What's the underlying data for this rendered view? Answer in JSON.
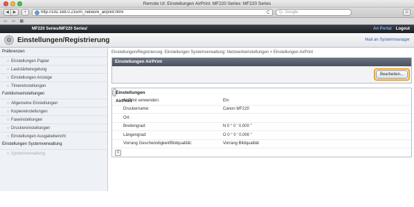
{
  "window": {
    "title": "Remote UI: Einstellungen AirPrint: MF220 Series: MF220 Series"
  },
  "browser": {
    "back": "◀",
    "forward": "▶",
    "add": "+",
    "url": "http://192.168.0.215/m_network_airprint.html",
    "reload": "C",
    "search_placeholder": "Q- Google",
    "bookmarks": [
      "▭",
      "▭",
      "▦"
    ]
  },
  "appbar": {
    "brand": "MF220 Series/MF220 Series/",
    "portal": "An Portal",
    "logout": "Logout"
  },
  "header": {
    "title": "Einstellungen/Registrierung",
    "right_link": "Mail an Systemmanager"
  },
  "sidebar": {
    "sections": [
      {
        "heading": "Präferenzen",
        "items": [
          {
            "label": "Einstellungen Papier"
          },
          {
            "label": "Lautstärkeregelung"
          },
          {
            "label": "Einstellungen Anzeige"
          },
          {
            "label": "Timereinstellungen"
          }
        ]
      },
      {
        "heading": "Funktionseinstellungen",
        "items": [
          {
            "label": "Allgemeine Einstellungen"
          },
          {
            "label": "Kopiereinstellungen"
          },
          {
            "label": "Faxeinstellungen"
          },
          {
            "label": "Druckereinstellungen"
          },
          {
            "label": "Einstellungen Ausgabebericht"
          }
        ]
      },
      {
        "heading": "Einstellungen Systemverwaltung",
        "items": [
          {
            "label": "Systemverwaltung"
          }
        ]
      }
    ]
  },
  "main": {
    "breadcrumb": "Einstellungen/Registrierung: Einstellungen Systemverwaltung: Netzwerkeinstellungen > Einstellungen AirPrint",
    "panel1": {
      "title": "Einstellungen AirPrint",
      "edit_label": "Bearbeiten..."
    },
    "panel2": {
      "title": "Einstellungen AirPrint",
      "rows": [
        {
          "key": "AirPrint verwenden:",
          "value": "Ein"
        },
        {
          "key": "Druckername:",
          "value": "Canon MF220"
        },
        {
          "key": "Ort:",
          "value": ""
        },
        {
          "key": "Breitengrad:",
          "value": "N 0 ° 0 ' 0.000 \""
        },
        {
          "key": "Längengrad:",
          "value": "O 0 ° 0 ' 0.000 \""
        },
        {
          "key": "Vorrang Geschwindigkeit/Bildqualität:",
          "value": "Vorrang Bildqualität"
        }
      ]
    },
    "footer_icon": "≡"
  },
  "colors": {
    "accent_highlight": "#f4a21d",
    "panel_header": "#5a6271",
    "app_bar": "#2a2e35"
  }
}
